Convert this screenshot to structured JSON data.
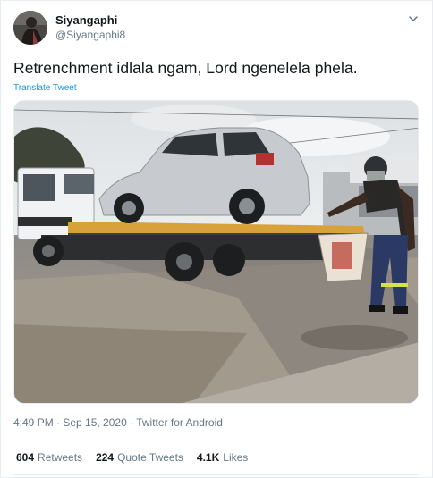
{
  "author": {
    "display_name": "Siyangaphi",
    "handle": "@Siyangaphi8"
  },
  "tweet": {
    "text": "Retrenchment idlala ngam, Lord ngenelela phela.",
    "translate_label": "Translate Tweet",
    "timestamp": "4:49 PM · Sep 15, 2020 · Twitter for Android"
  },
  "stats": {
    "retweets_count": "604",
    "retweets_label": "Retweets",
    "quote_count": "224",
    "quote_label": "Quote Tweets",
    "likes_count": "4.1K",
    "likes_label": "Likes"
  },
  "icons": {
    "menu": "chevron-down-icon"
  },
  "colors": {
    "link": "#1b95e0",
    "secondary_text": "#657786",
    "primary_text": "#14171a",
    "border": "#e6ecf0"
  }
}
